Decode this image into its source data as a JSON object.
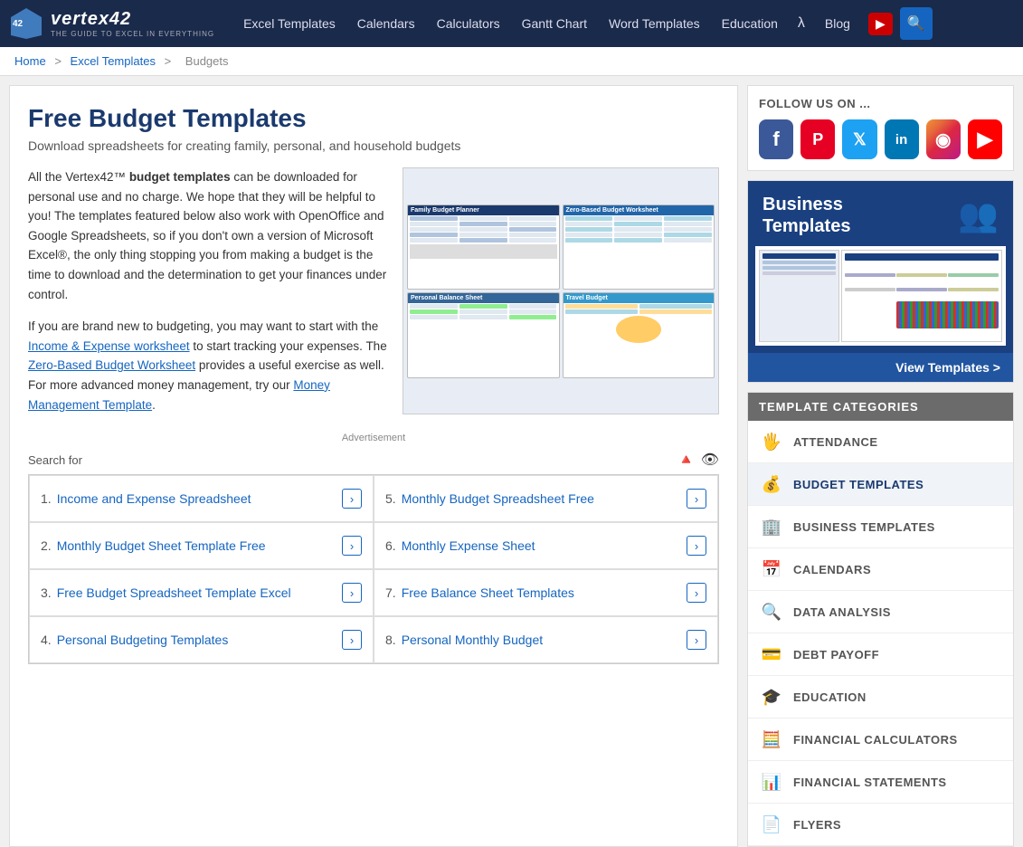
{
  "header": {
    "logo_text": "vertex42",
    "logo_sub": "THE GUIDE TO EXCEL IN EVERYTHING",
    "nav_items": [
      {
        "label": "Excel Templates",
        "href": "#"
      },
      {
        "label": "Calendars",
        "href": "#"
      },
      {
        "label": "Calculators",
        "href": "#"
      },
      {
        "label": "Gantt Chart",
        "href": "#"
      },
      {
        "label": "Word Templates",
        "href": "#"
      },
      {
        "label": "Education",
        "href": "#"
      },
      {
        "label": "Blog",
        "href": "#"
      }
    ]
  },
  "breadcrumb": {
    "items": [
      {
        "label": "Home",
        "href": "#"
      },
      {
        "label": "Excel Templates",
        "href": "#"
      },
      {
        "label": "Budgets",
        "href": "#"
      }
    ]
  },
  "main": {
    "title": "Free Budget Templates",
    "subtitle": "Download spreadsheets for creating family, personal, and household budgets",
    "intro_p1": "All the Vertex42™ ",
    "intro_bold": "budget templates",
    "intro_p2": " can be downloaded for personal use and no charge. We hope that they will be helpful to you! The templates featured below also work with OpenOffice and Google Spreadsheets, so if you don't own a version of Microsoft Excel®, the only thing stopping you from making a budget is the time to download and the determination to get your finances under control.",
    "intro_p3": "If you are brand new to budgeting, you may want to start with the ",
    "intro_link1": "Income & Expense worksheet",
    "intro_p4": " to start tracking your expenses. The ",
    "intro_link2": "Zero-Based Budget Worksheet",
    "intro_p5": " provides a useful exercise as well. For more advanced money management, try our ",
    "intro_link3": "Money Management Template",
    "intro_p6": ".",
    "ad_label": "Advertisement",
    "search_for_label": "Search for",
    "search_items_left": [
      {
        "num": "1.",
        "label": "Income and Expense Spreadsheet"
      },
      {
        "num": "2.",
        "label": "Monthly Budget Sheet Template Free"
      },
      {
        "num": "3.",
        "label": "Free Budget Spreadsheet Template Excel"
      },
      {
        "num": "4.",
        "label": "Personal Budgeting Templates"
      }
    ],
    "search_items_right": [
      {
        "num": "5.",
        "label": "Monthly Budget Spreadsheet Free"
      },
      {
        "num": "6.",
        "label": "Monthly Expense Sheet"
      },
      {
        "num": "7.",
        "label": "Free Balance Sheet Templates"
      },
      {
        "num": "8.",
        "label": "Personal Monthly Budget"
      }
    ]
  },
  "sidebar": {
    "follow_title": "FOLLOW US ON ...",
    "social": [
      {
        "name": "Facebook",
        "class": "si-fb",
        "symbol": "f"
      },
      {
        "name": "Pinterest",
        "class": "si-pin",
        "symbol": "P"
      },
      {
        "name": "Twitter",
        "class": "si-tw",
        "symbol": "t"
      },
      {
        "name": "LinkedIn",
        "class": "si-li",
        "symbol": "in"
      },
      {
        "name": "Instagram",
        "class": "si-ig",
        "symbol": "◉"
      },
      {
        "name": "YouTube",
        "class": "si-yt",
        "symbol": "▶"
      }
    ],
    "biz_title": "Business\nTemplates",
    "biz_view_btn": "View Templates >",
    "categories_header": "TEMPLATE CATEGORIES",
    "categories": [
      {
        "label": "ATTENDANCE",
        "icon": "✋",
        "active": false
      },
      {
        "label": "BUDGET TEMPLATES",
        "icon": "💰",
        "active": true
      },
      {
        "label": "BUSINESS TEMPLATES",
        "icon": "🏢",
        "active": false
      },
      {
        "label": "CALENDARS",
        "icon": "📅",
        "active": false
      },
      {
        "label": "DATA ANALYSIS",
        "icon": "🔍",
        "active": false
      },
      {
        "label": "DEBT PAYOFF",
        "icon": "💳",
        "active": false
      },
      {
        "label": "EDUCATION",
        "icon": "🎓",
        "active": false
      },
      {
        "label": "FINANCIAL CALCULATORS",
        "icon": "🧮",
        "active": false
      },
      {
        "label": "FINANCIAL STATEMENTS",
        "icon": "📊",
        "active": false
      },
      {
        "label": "FLYERS",
        "icon": "📄",
        "active": false
      }
    ]
  }
}
